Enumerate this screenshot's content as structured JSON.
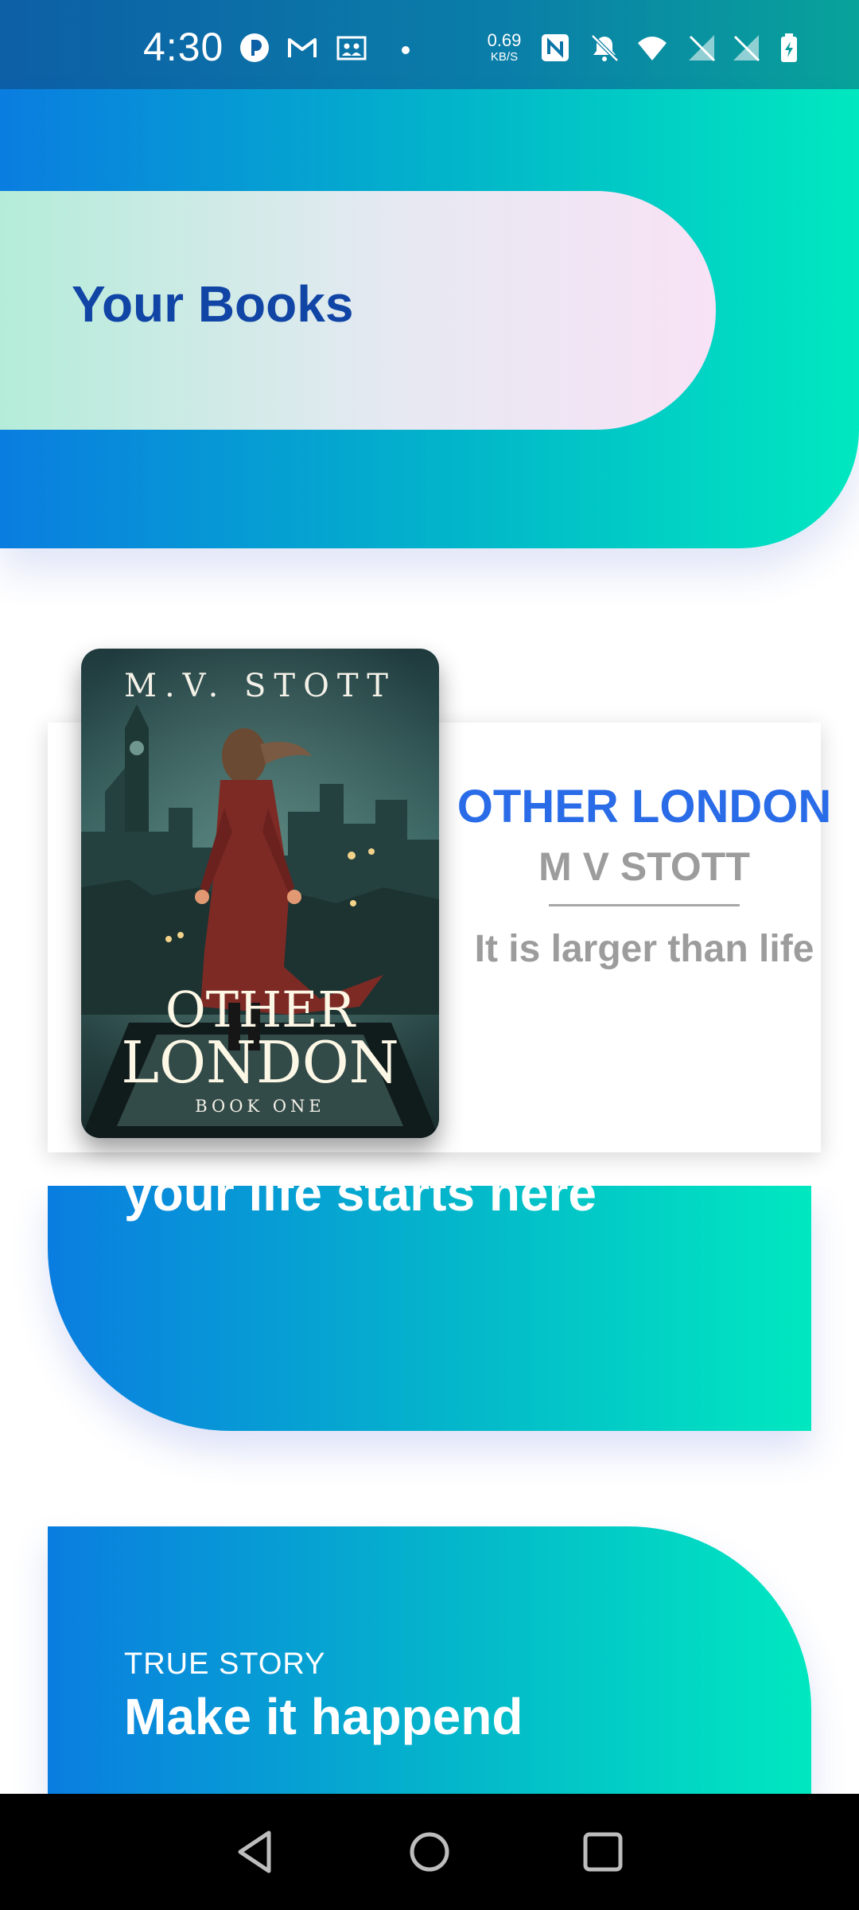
{
  "status_bar": {
    "time": "4:30",
    "net_speed_value": "0.69",
    "net_speed_unit": "KB/S",
    "icons": [
      "app-notification-icon",
      "gmail-icon",
      "photo-icon",
      "dot-icon",
      "nfc-icon",
      "bell-off-icon",
      "wifi-icon",
      "signal-icon",
      "signal-2-icon",
      "battery-charging-icon"
    ]
  },
  "header": {
    "title": "Your Books"
  },
  "book": {
    "title": "OTHER LONDON",
    "author": "M V STOTT",
    "tagline": "It is larger than life",
    "cover": {
      "author_line": "M.V. STOTT",
      "title_line_1": "OTHER",
      "title_line_2": "LONDON",
      "series_line": "BOOK ONE"
    }
  },
  "cards": [
    {
      "headline": "your life starts here"
    },
    {
      "label": "TRUE STORY",
      "headline": "Make it happend"
    }
  ],
  "nav_bar": {
    "buttons": [
      "back-icon",
      "home-icon",
      "recents-icon"
    ]
  },
  "colors": {
    "brand_blue": "#0a7de0",
    "brand_teal": "#00e8c0",
    "header_text": "#1045a6",
    "book_title": "#2a6ce8",
    "muted_text": "#9c9c9c"
  }
}
